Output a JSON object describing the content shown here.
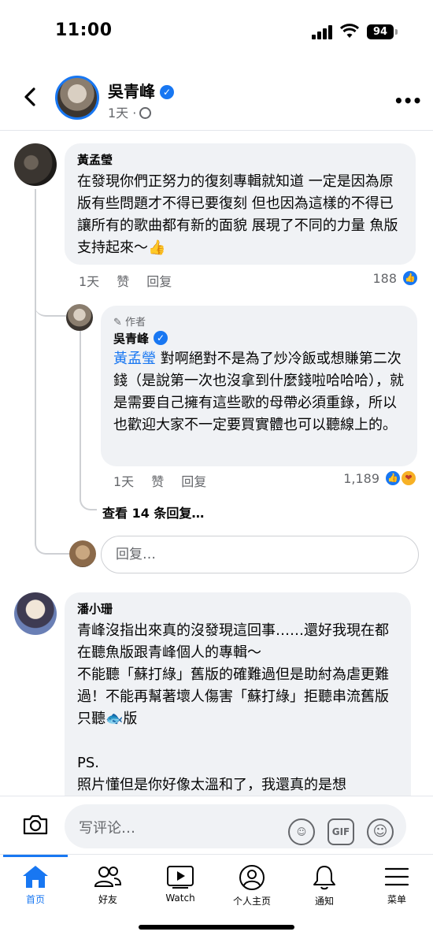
{
  "status_bar": {
    "time": "11:00",
    "battery": "94"
  },
  "header": {
    "name": "吳青峰",
    "time": "1天",
    "separator": "·"
  },
  "comments": [
    {
      "name": "黃孟瑩",
      "text": "在發現你們正努力的復刻專輯就知道 一定是因為原版有些問題才不得已要復刻 但也因為這樣的不得已讓所有的歌曲都有新的面貌 展現了不同的力量  魚版支持起來～👍",
      "time": "1天",
      "like": "赞",
      "reply": "回复",
      "reaction_count": "188",
      "replies": [
        {
          "author_tag": "作者",
          "name": "吳青峰",
          "mention": "黃孟瑩",
          "text": " 對啊絕對不是為了炒冷飯或想賺第二次錢（是說第一次也沒拿到什麼錢啦哈哈哈），就是需要自己擁有這些歌的母帶必須重錄，所以也歡迎大家不一定要買實體也可以聽線上的。",
          "time": "1天",
          "like": "赞",
          "reply": "回复",
          "reaction_count": "1,189"
        }
      ],
      "view_replies": "查看 14 条回复…",
      "reply_placeholder": "回复…"
    },
    {
      "name": "潘小珊",
      "text": "青峰沒指出來真的沒發現這回事……還好我現在都在聽魚版跟青峰個人的專輯～\n不能聽「蘇打綠」舊版的確難過但是助紂為虐更難過！不能再幫著壞人傷害「蘇打綠」拒聽串流舊版只聽🐟版\n\nPS.\n照片懂但是你好像太溫和了，我還真的是想"
    }
  ],
  "comment_bar": {
    "placeholder": "写评论…",
    "gif_label": "GIF"
  },
  "tabs": [
    {
      "label": "首页",
      "icon": "home-icon",
      "active": true
    },
    {
      "label": "好友",
      "icon": "friends-icon",
      "active": false
    },
    {
      "label": "Watch",
      "icon": "watch-icon",
      "active": false
    },
    {
      "label": "个人主页",
      "icon": "profile-icon",
      "active": false
    },
    {
      "label": "通知",
      "icon": "bell-icon",
      "active": false
    },
    {
      "label": "菜单",
      "icon": "menu-icon",
      "active": false
    }
  ],
  "colors": {
    "accent": "#1877f2",
    "bubble": "#f0f2f5",
    "secondary_text": "#65676b"
  }
}
